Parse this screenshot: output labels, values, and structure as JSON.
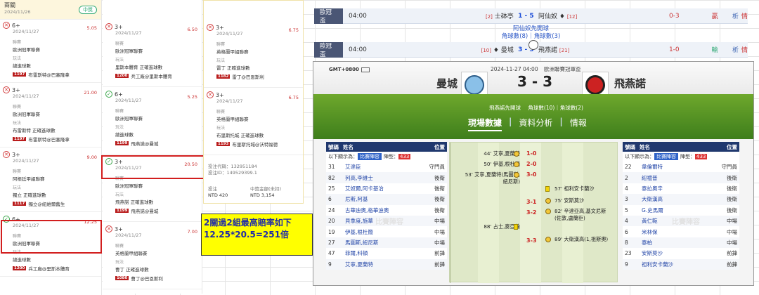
{
  "col1": {
    "title": "兩關",
    "date": "2024/11/26",
    "badge": "中獎",
    "cards": [
      {
        "status": "lose",
        "title": "6+",
        "date": "2024/11/27",
        "odds": "5.05",
        "lg_lbl": "聯賽",
        "lg": "歐洲冠軍聯賽",
        "pl_lbl": "玩法",
        "pl": "總進球數",
        "n": "1197",
        "match": "布雷斯特@巴塞隆拿"
      },
      {
        "status": "lose",
        "title": "3+",
        "date": "2024/11/27",
        "odds": "21.00",
        "lg_lbl": "聯賽",
        "lg": "歐洲冠軍聯賽",
        "pl_lbl": "玩法",
        "pl": "布雷斯特 正確進球數",
        "n": "1197",
        "match": "布雷斯特@巴塞隆拿"
      },
      {
        "status": "lose",
        "title": "3+",
        "date": "2024/11/27",
        "odds": "9.00",
        "lg_lbl": "聯賽",
        "lg": "阿根廷甲組聯賽",
        "pl_lbl": "玩法",
        "pl": "獨立 正確進球數",
        "n": "1117",
        "match": "獨立@紐維爾舊生"
      },
      {
        "status": "win",
        "title": "6+",
        "date": "2024/11/27",
        "odds": "12.25",
        "lg_lbl": "聯賽",
        "lg": "歐洲冠軍聯賽",
        "pl_lbl": "玩法",
        "pl": "總進球數",
        "n": "1200",
        "match": "兵工廠@里斯本體育"
      }
    ]
  },
  "col2": {
    "cards": [
      {
        "status": "lose",
        "title": "3+",
        "date": "2024/11/27",
        "odds": "6.50",
        "lg_lbl": "聯賽",
        "lg": "歐洲冠軍聯賽",
        "pl_lbl": "玩法",
        "pl": "里斯本體育 正確進球數",
        "n": "1200",
        "match": "兵工廠@里斯本體育"
      },
      {
        "status": "win",
        "title": "6+",
        "date": "2024/11/27",
        "odds": "5.25",
        "lg_lbl": "聯賽",
        "lg": "歐洲冠軍聯賽",
        "pl_lbl": "玩法",
        "pl": "總進球數",
        "n": "1199",
        "match": "飛燕諾@曼城"
      },
      {
        "status": "win",
        "title": "3+",
        "date": "2024/11/27",
        "odds": "20.50",
        "lg_lbl": "聯賽",
        "lg": "歐洲冠軍聯賽",
        "pl_lbl": "玩法",
        "pl": "飛燕諾 正確進球數",
        "n": "1199",
        "match": "飛燕諾@曼城"
      },
      {
        "status": "lose",
        "title": "3+",
        "date": "2024/11/27",
        "odds": "7.00",
        "lg_lbl": "聯賽",
        "lg": "英格蘭甲組聯賽",
        "pl_lbl": "玩法",
        "pl": "曹丁 正確進球數",
        "n": "1080",
        "match": "曹丁@巴恩斯利"
      }
    ]
  },
  "col3": {
    "cards": [
      {
        "status": "lose",
        "title": "3+",
        "date": "2024/11/27",
        "odds": "6.75",
        "lg_lbl": "聯賽",
        "lg": "英格蘭甲組聯賽",
        "pl_lbl": "玩法",
        "pl": "雷丁 正確進球數",
        "n": "1182",
        "match": "雷丁@巴恩斯利"
      },
      {
        "status": "lose",
        "title": "3+",
        "date": "2024/11/27",
        "odds": "6.75",
        "lg_lbl": "聯賽",
        "lg": "英格蘭甲組聯賽",
        "pl_lbl": "玩法",
        "pl": "布里斯托城 正確進球數",
        "n": "1193",
        "match": "布里斯托城@沃特福德"
      }
    ],
    "id_lbl1": "投注代碼：",
    "id1": "132951184",
    "id_lbl2": "投注ID：",
    "id2": "149529399.1",
    "stake_lbl": "投注",
    "stake": "NTD 420",
    "win_lbl": "中獎金額(未扣)",
    "win": "NTD 3,154"
  },
  "callout": {
    "line1": "2關過2組最高賠率如下",
    "line2": "12.25*20.5=251倍"
  },
  "row1": {
    "league": "歐冠盃",
    "time": "04:00",
    "home_rank": "[2]",
    "home": "士砵亭",
    "score": "1 - 5",
    "away": "阿仙奴",
    "away_rank": "[12]",
    "ht": "0-3",
    "res": "贏",
    "a1": "析",
    "a2": "情"
  },
  "sub": {
    "l1": "阿仙奴先開球",
    "l2": "角球數(8)｜角球數(3)"
  },
  "row2": {
    "league": "歐冠盃",
    "time": "04:00",
    "home_rank": "[10]",
    "home": "曼城",
    "score": "3 - 3",
    "away": "飛燕諾",
    "away_rank": "[21]",
    "ht": "1-0",
    "res": "輸",
    "a1": "析",
    "a2": "情"
  },
  "panel": {
    "gmt": "GMT+0800",
    "datetime": "2024-11-27 04:00",
    "league": "歐洲聯賽冠軍盃",
    "home": "曼城",
    "away": "飛燕諾",
    "score": "3 - 3",
    "kick": "飛燕諾先開球",
    "corners": "角球數(10)｜角球數(2)",
    "tabs": [
      "現場數據",
      "資料分析",
      "情報"
    ],
    "hdr_no": "號碼",
    "hdr_name": "姓名",
    "hdr_pos": "位置",
    "show": "以下顯示為：",
    "lineup_btn": "比賽陣容",
    "formation_lbl": "陣型：",
    "formation": "433",
    "watermark": "比賽陣容",
    "home_players": [
      {
        "no": "31",
        "name": "艾達臣",
        "pos": "守門員"
      },
      {
        "no": "82",
        "name": "列高,李維士",
        "pos": "後衛"
      },
      {
        "no": "25",
        "name": "艾奴爾,阿卡基治",
        "pos": "後衛"
      },
      {
        "no": "6",
        "name": "尼斯,阿基",
        "pos": "後衛"
      },
      {
        "no": "24",
        "name": "古華迪奧,格華迪奧",
        "pos": "後衛"
      },
      {
        "no": "20",
        "name": "貝拿度,施華",
        "pos": "中場"
      },
      {
        "no": "19",
        "name": "伊基,根杜簡",
        "pos": "中場"
      },
      {
        "no": "27",
        "name": "馬圖斯,紐尼斯",
        "pos": "中場"
      },
      {
        "no": "47",
        "name": "菲爾,科頓",
        "pos": "前鋒"
      },
      {
        "no": "9",
        "name": "艾寧,夏蘭特",
        "pos": "前鋒"
      }
    ],
    "away_players": [
      {
        "no": "22",
        "name": "韋倫爾特",
        "pos": "守門員"
      },
      {
        "no": "2",
        "name": "紐禮普",
        "pos": "後衛"
      },
      {
        "no": "4",
        "name": "泰拉奧辛",
        "pos": "後衛"
      },
      {
        "no": "3",
        "name": "大衛漢高",
        "pos": "後衛"
      },
      {
        "no": "5",
        "name": "G.史馬爾",
        "pos": "後衛"
      },
      {
        "no": "4",
        "name": "黃仁範",
        "pos": "中場"
      },
      {
        "no": "6",
        "name": "米林保",
        "pos": "中場"
      },
      {
        "no": "8",
        "name": "泰柏",
        "pos": "中場"
      },
      {
        "no": "23",
        "name": "安斯莫沙",
        "pos": "前鋒"
      },
      {
        "no": "9",
        "name": "祖利安卡蘭沙",
        "pos": "前鋒"
      }
    ],
    "events": [
      {
        "t": "44' 艾寧,夏蘭特",
        "s": "1-0"
      },
      {
        "t": "50' 伊基,根杜簡",
        "s": "2-0"
      },
      {
        "t": "53' 艾寧,夏蘭特(馬圖斯,\n紐尼斯)",
        "s": "3-0"
      },
      {
        "t": "88' 占士,麥亞倫",
        "s": ""
      }
    ],
    "away_events": [
      {
        "t": "57' 祖利安卡蘭沙",
        "s": ""
      },
      {
        "t": "75' 安斯莫沙",
        "s": "3-1"
      },
      {
        "t": "82' 辛達亞高,基文尼斯\n(佐敦,盧蘭臣)",
        "s": "3-2"
      },
      {
        "t": "89' 大衛漢高(1,祖斯奧)",
        "s": "3-3"
      }
    ]
  }
}
